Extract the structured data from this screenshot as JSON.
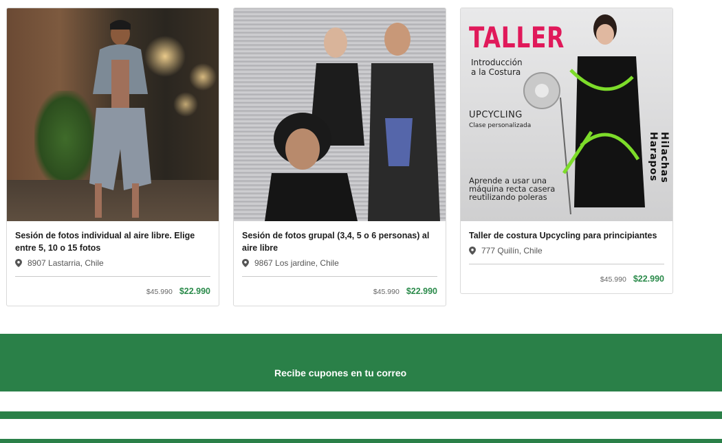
{
  "cards": [
    {
      "title": "Sesión de fotos individual al aire libre. Elige entre 5, 10 o 15 fotos",
      "location": "8907 Lastarria, Chile",
      "old_price": "$45.990",
      "new_price": "$22.990"
    },
    {
      "title": "Sesión de fotos grupal (3,4, 5 o 6 personas) al aire libre",
      "location": "9867 Los jardine, Chile",
      "old_price": "$45.990",
      "new_price": "$22.990"
    },
    {
      "title": "Taller de costura Upcycling para principiantes",
      "location": "777 Quilín, Chile",
      "old_price": "$45.990",
      "new_price": "$22.990",
      "poster": {
        "headline": "TALLER",
        "line1": "Introducción",
        "line2": "a la Costura",
        "line3": "UPCYCLING",
        "line4": "Clase personalizada",
        "line5": "Aprende a usar una",
        "line6": "máquina recta casera",
        "line7": "reutilizando poleras",
        "brand": "Hilachas Harapos"
      }
    }
  ],
  "newsletter": {
    "cta": "Recibe cupones en tu correo"
  },
  "colors": {
    "brand_green": "#2a8048",
    "price_green": "#2a8a4a",
    "poster_pink": "#e0195a"
  },
  "icons": {
    "location": "map-pin-icon"
  }
}
